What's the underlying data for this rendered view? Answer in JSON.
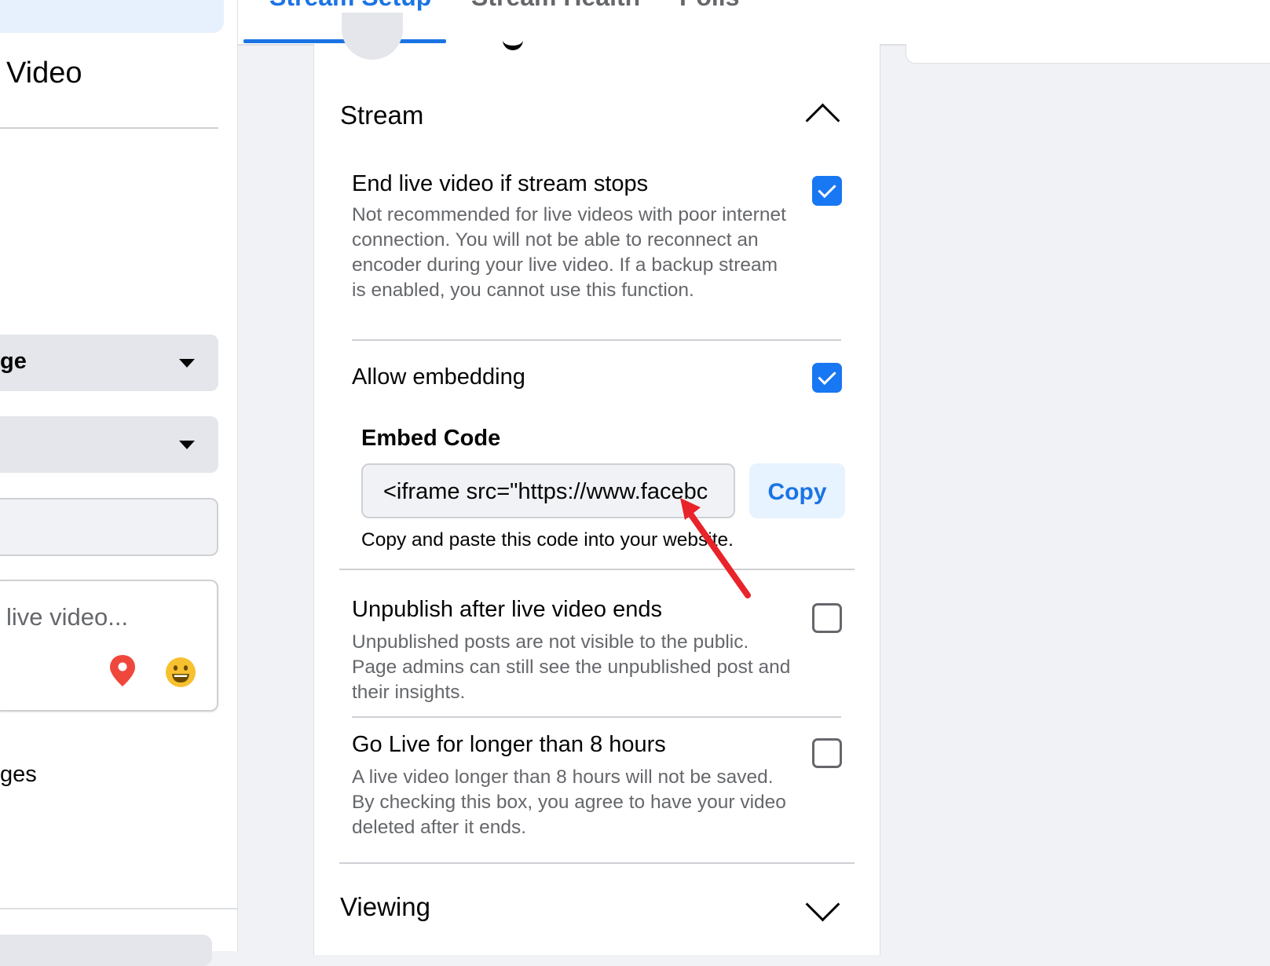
{
  "sidebar": {
    "title": "Video",
    "select_1": "ge",
    "select_2": "",
    "composer_placeholder": "live video...",
    "pages_label": "ges"
  },
  "tabs": [
    {
      "label": "Stream Setup",
      "active": true
    },
    {
      "label": "Stream Health",
      "active": false
    },
    {
      "label": "Polls",
      "active": false
    }
  ],
  "stream_section": {
    "title": "Stream",
    "expanded": true,
    "options": {
      "end_live": {
        "label": "End live video if stream stops",
        "description": "Not recommended for live videos with poor internet connection. You will not be able to reconnect an encoder during your live video. If a backup stream is enabled, you cannot use this function.",
        "checked": true
      },
      "allow_embedding": {
        "label": "Allow embedding",
        "checked": true,
        "embed_code_title": "Embed Code",
        "embed_code_value": "<iframe src=\"https://www.facebc",
        "copy_label": "Copy",
        "hint": "Copy and paste this code into your website."
      },
      "unpublish": {
        "label": "Unpublish after live video ends",
        "description": "Unpublished posts are not visible to the public. Page admins can still see the unpublished post and their insights.",
        "checked": false
      },
      "long_live": {
        "label": "Go Live for longer than 8 hours",
        "description": "A live video longer than 8 hours will not be saved. By checking this box, you agree to have your video deleted after it ends.",
        "checked": false
      }
    }
  },
  "viewing_section": {
    "title": "Viewing",
    "expanded": false
  },
  "colors": {
    "accent": "#1877f2",
    "tab_active": "#1b74e4",
    "annotation_arrow": "#e8232a",
    "pin": "#f0473c",
    "emoji": "#f7c02f"
  },
  "icons": {
    "location": "location-pin-icon",
    "emoji": "smiley-face-icon",
    "collapse": "chevron-up-icon",
    "expand": "chevron-down-icon"
  }
}
